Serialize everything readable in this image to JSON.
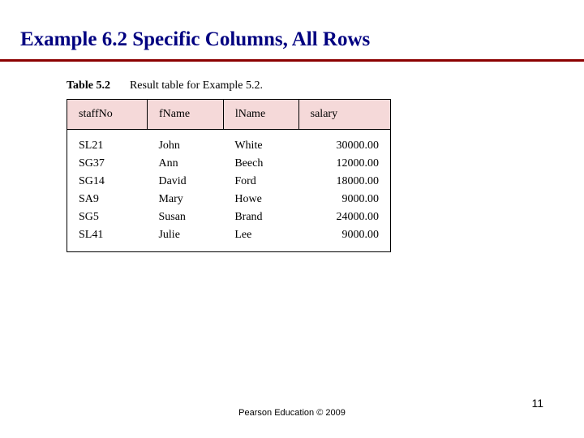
{
  "title": "Example 6.2  Specific Columns, All Rows",
  "tableCaption": {
    "label": "Table 5.2",
    "desc": "Result table for Example 5.2."
  },
  "headers": {
    "staffNo": "staffNo",
    "fName": "fName",
    "lName": "lName",
    "salary": "salary"
  },
  "rows": [
    {
      "staffNo": "SL21",
      "fName": "John",
      "lName": "White",
      "salary": "30000.00"
    },
    {
      "staffNo": "SG37",
      "fName": "Ann",
      "lName": "Beech",
      "salary": "12000.00"
    },
    {
      "staffNo": "SG14",
      "fName": "David",
      "lName": "Ford",
      "salary": "18000.00"
    },
    {
      "staffNo": "SA9",
      "fName": "Mary",
      "lName": "Howe",
      "salary": "9000.00"
    },
    {
      "staffNo": "SG5",
      "fName": "Susan",
      "lName": "Brand",
      "salary": "24000.00"
    },
    {
      "staffNo": "SL41",
      "fName": "Julie",
      "lName": "Lee",
      "salary": "9000.00"
    }
  ],
  "footer": "Pearson Education © 2009",
  "pageNumber": "11"
}
